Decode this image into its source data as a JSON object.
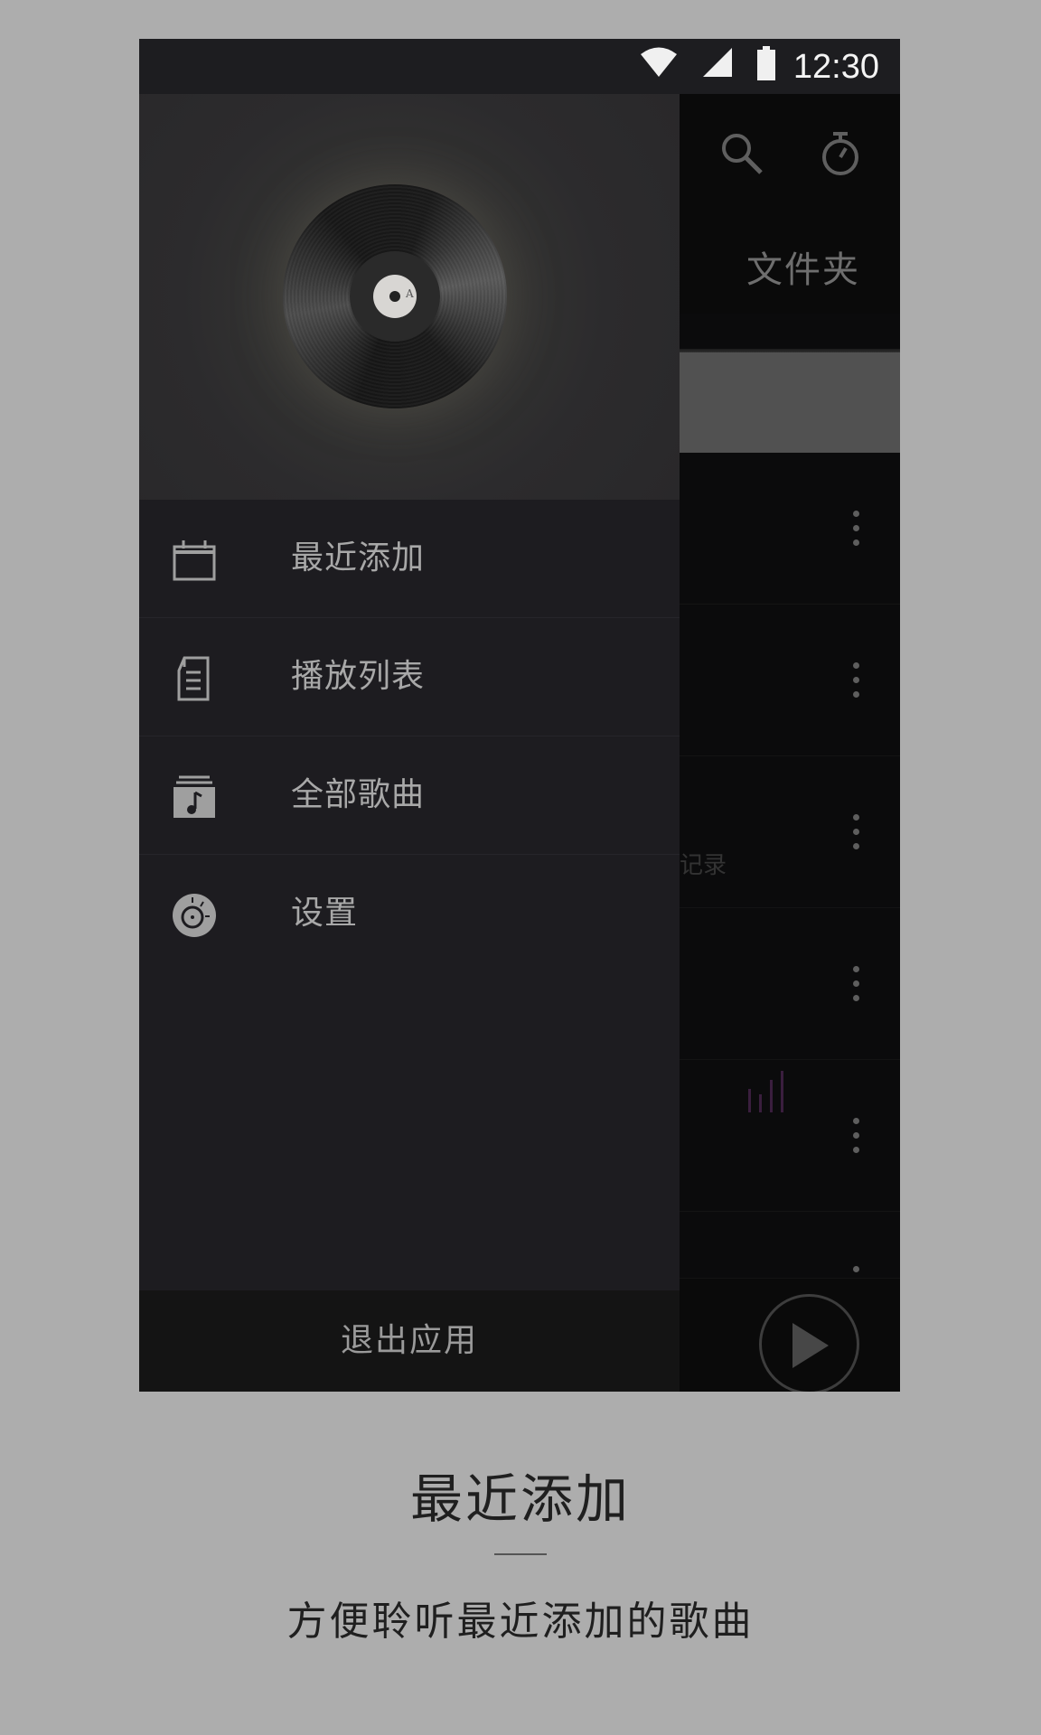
{
  "status_bar": {
    "time": "12:30",
    "icons": [
      "wifi-icon",
      "cellular-signal-icon",
      "battery-icon"
    ]
  },
  "background_app": {
    "toolbar_icons": [
      "search-icon",
      "timer-icon"
    ],
    "tab_label": "文件夹",
    "partial_row_text": "记录",
    "row_count": 6
  },
  "drawer": {
    "header_image": "vinyl-record",
    "items": [
      {
        "label": "最近添加",
        "icon": "calendar-icon"
      },
      {
        "label": "播放列表",
        "icon": "playlist-icon"
      },
      {
        "label": "全部歌曲",
        "icon": "music-library-icon"
      },
      {
        "label": "设置",
        "icon": "settings-dial-icon"
      }
    ],
    "footer_label": "退出应用"
  },
  "caption": {
    "title": "最近添加",
    "subtitle": "方便聆听最近添加的歌曲"
  },
  "colors": {
    "page_background": "#adadad",
    "drawer_background": "#1d1c20",
    "text_primary": "#a8a8a8",
    "eq_accent": "#3a1e3e"
  }
}
